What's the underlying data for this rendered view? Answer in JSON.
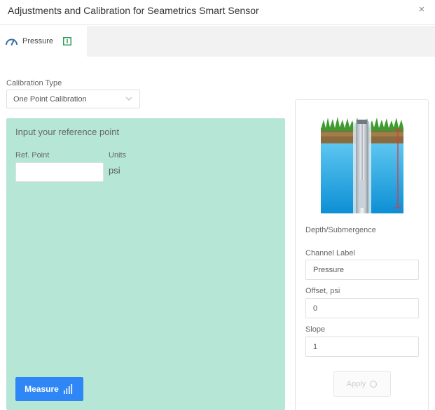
{
  "dialog": {
    "title": "Adjustments and Calibration for Seametrics Smart Sensor",
    "close_glyph": "×"
  },
  "tabs": [
    {
      "label": "Pressure",
      "icon": "gauge-icon",
      "info_icon": "info-icon",
      "active": true
    }
  ],
  "calibration": {
    "type_label": "Calibration Type",
    "type_value": "One Point Calibration"
  },
  "reference": {
    "heading": "Input your reference point",
    "ref_point_label": "Ref. Point",
    "ref_point_value": "",
    "units_label": "Units",
    "units_value": "psi",
    "measure_label": "Measure"
  },
  "sensor_card": {
    "caption": "Depth/Submergence",
    "channel_label_label": "Channel Label",
    "channel_label_value": "Pressure",
    "offset_label": "Offset, psi",
    "offset_value": "0",
    "slope_label": "Slope",
    "slope_value": "1",
    "apply_label": "Apply"
  },
  "colors": {
    "accent_blue": "#2f86f6",
    "panel_green": "#b6e7d6",
    "tab_icon_green": "#2e9e57",
    "water_blue": "#1aa3e0"
  }
}
